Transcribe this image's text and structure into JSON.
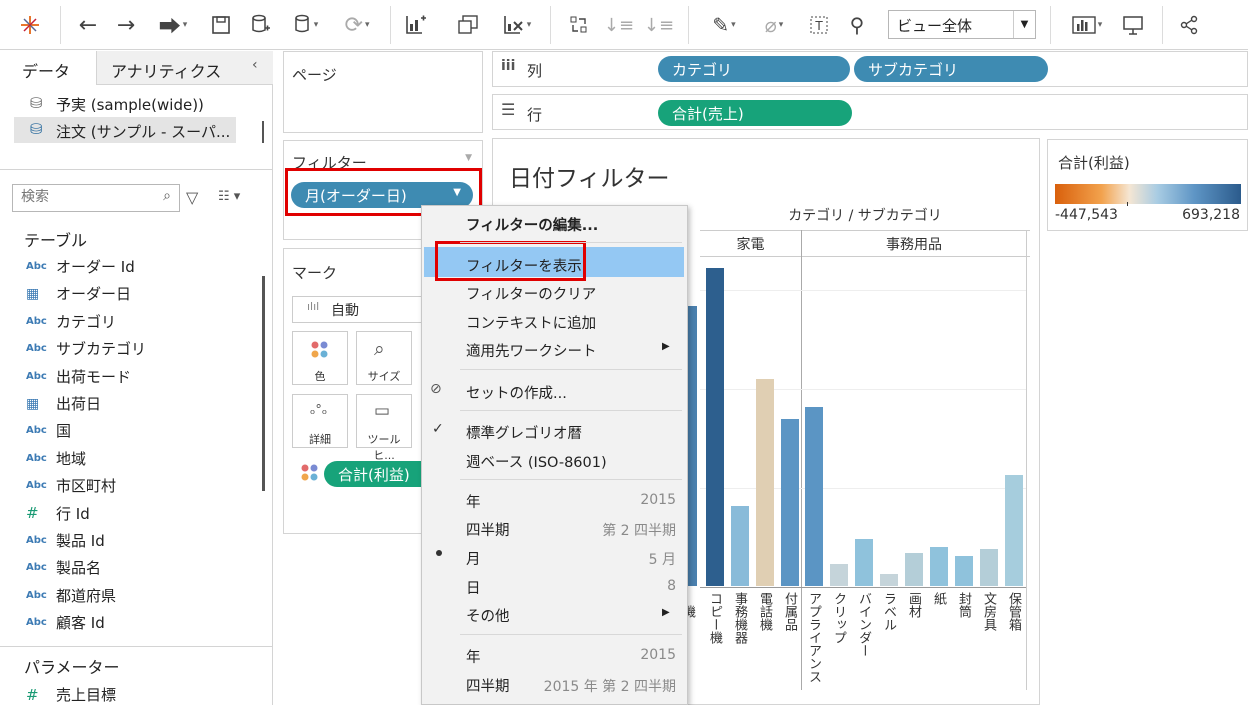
{
  "toolbar": {
    "view_select_value": "ビュー全体"
  },
  "left_pane": {
    "tabs": [
      "データ",
      "アナリティクス"
    ],
    "datasources": [
      "予実 (sample(wide))",
      "注文 (サンプル - スーパ..."
    ],
    "search_placeholder": "検索",
    "tables_heading": "テーブル",
    "fields": [
      {
        "type": "Abc",
        "name": "オーダー Id"
      },
      {
        "type": "date",
        "name": "オーダー日"
      },
      {
        "type": "Abc",
        "name": "カテゴリ"
      },
      {
        "type": "Abc",
        "name": "サブカテゴリ"
      },
      {
        "type": "Abc",
        "name": "出荷モード"
      },
      {
        "type": "date",
        "name": "出荷日"
      },
      {
        "type": "Abc",
        "name": "国"
      },
      {
        "type": "Abc",
        "name": "地域"
      },
      {
        "type": "Abc",
        "name": "市区町村"
      },
      {
        "type": "#",
        "name": "行 Id"
      },
      {
        "type": "Abc",
        "name": "製品 Id"
      },
      {
        "type": "Abc",
        "name": "製品名"
      },
      {
        "type": "Abc",
        "name": "都道府県"
      },
      {
        "type": "Abc",
        "name": "顧客 Id"
      }
    ],
    "params_heading": "パラメーター",
    "params": [
      {
        "type": "#",
        "name": "売上目標"
      }
    ]
  },
  "shelves": {
    "pages_label": "ページ",
    "filters_label": "フィルター",
    "filter_pill": "月(オーダー日)",
    "marks_label": "マーク",
    "mark_type": "自動",
    "mark_buttons": [
      "色",
      "サイズ",
      "詳細",
      "ツールヒ..."
    ],
    "mark_pill": "合計(利益)",
    "columns_label": "列",
    "columns_pills": [
      "カテゴリ",
      "サブカテゴリ"
    ],
    "rows_label": "行",
    "rows_pills": [
      "合計(売上)"
    ]
  },
  "view": {
    "title": "日付フィルター",
    "header": "カテゴリ / サブカテゴリ",
    "legend_title": "合計(利益)",
    "legend_min": "-447,543",
    "legend_max": "693,218"
  },
  "chart_data": {
    "type": "bar",
    "groups": [
      "家電",
      "事務用品"
    ],
    "categories": [
      "…機",
      "コピー機",
      "事務機器",
      "電話機",
      "付属品",
      "アプライアンス",
      "クリップ",
      "バインダー",
      "ラベル",
      "画材",
      "紙",
      "封筒",
      "文房具",
      "保管箱"
    ],
    "values": [
      280,
      318,
      80,
      207,
      167,
      179,
      22,
      47,
      12,
      33,
      39,
      30,
      37,
      111
    ],
    "profit_color_hex": [
      "#4a80ae",
      "#2d5f8e",
      "#89bbd9",
      "#e0cfb3",
      "#5b95c4",
      "#5b95c4",
      "#c5d4da",
      "#8fc2dc",
      "#c5d4da",
      "#b4ced8",
      "#8fc2dc",
      "#8fc2dc",
      "#b4ced8",
      "#a6cddd"
    ]
  },
  "context_menu": {
    "items": [
      {
        "label": "フィルターの編集...",
        "bold": true
      },
      {
        "label": "フィルターを表示",
        "highlight": true
      },
      {
        "label": "フィルターのクリア"
      },
      {
        "label": "コンテキストに追加"
      },
      {
        "label": "適用先ワークシート",
        "submenu": true
      },
      {
        "label": "セットの作成..."
      },
      {
        "label": "標準グレゴリオ暦",
        "checked": true
      },
      {
        "label": "週ベース (ISO-8601)"
      },
      {
        "label": "年",
        "value": "2015"
      },
      {
        "label": "四半期",
        "value": "第 2 四半期"
      },
      {
        "label": "月",
        "value": "5 月",
        "bullet": true
      },
      {
        "label": "日",
        "value": "8"
      },
      {
        "label": "その他",
        "submenu": true
      },
      {
        "label": "年",
        "value": "2015"
      },
      {
        "label": "四半期",
        "value": "2015 年 第 2 四半期"
      }
    ]
  }
}
